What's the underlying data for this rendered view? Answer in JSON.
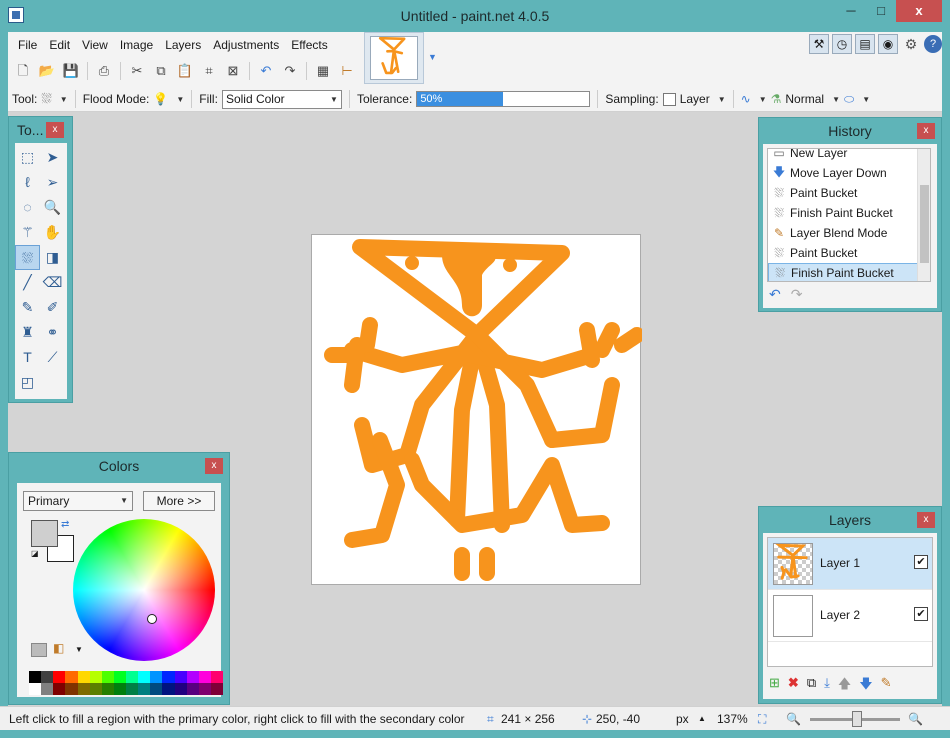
{
  "window": {
    "title": "Untitled - paint.net 4.0.5",
    "minimize": "─",
    "maximize": "□",
    "close": "x"
  },
  "menu": [
    "File",
    "Edit",
    "View",
    "Image",
    "Layers",
    "Adjustments",
    "Effects"
  ],
  "toolbar_top": {
    "tool_label": "Tool:",
    "flood_mode_label": "Flood Mode:",
    "fill_label": "Fill:",
    "fill_value": "Solid Color",
    "tolerance_label": "Tolerance:",
    "tolerance_value": "50%",
    "tolerance_fraction": 0.5,
    "sampling_label": "Sampling:",
    "sampling_value": "Layer",
    "blend_value": "Normal"
  },
  "history": {
    "title": "History",
    "close": "x",
    "items": [
      {
        "label": "New Layer",
        "icon": "new-layer-icon",
        "selected": false
      },
      {
        "label": "Move Layer Down",
        "icon": "move-down-icon",
        "selected": false
      },
      {
        "label": "Paint Bucket",
        "icon": "paint-bucket-icon",
        "selected": false
      },
      {
        "label": "Finish Paint Bucket",
        "icon": "paint-bucket-icon",
        "selected": false
      },
      {
        "label": "Layer Blend Mode",
        "icon": "layer-properties-icon",
        "selected": false
      },
      {
        "label": "Paint Bucket",
        "icon": "paint-bucket-icon",
        "selected": false
      },
      {
        "label": "Finish Paint Bucket",
        "icon": "paint-bucket-icon",
        "selected": true
      }
    ]
  },
  "tools": {
    "title": "To...",
    "close": "x"
  },
  "colors": {
    "title": "Colors",
    "close": "x",
    "mode": "Primary",
    "more_button": "More >>",
    "primary": "#cfcfcf",
    "secondary": "#ffffff",
    "palette": [
      "#000000",
      "#404040",
      "#ff0000",
      "#ff6a00",
      "#ffd800",
      "#b6ff00",
      "#4cff00",
      "#00ff21",
      "#00ff90",
      "#00ffff",
      "#0094ff",
      "#0026ff",
      "#4800ff",
      "#b200ff",
      "#ff00dc",
      "#ff006e",
      "#ffffff",
      "#808080",
      "#7f0000",
      "#7f3300",
      "#7f6a00",
      "#5b7f00",
      "#267f00",
      "#007f0e",
      "#007f46",
      "#007f7f",
      "#004a7f",
      "#00137f",
      "#21007f",
      "#57007f",
      "#7f006e",
      "#7f0037"
    ]
  },
  "layers": {
    "title": "Layers",
    "close": "x",
    "items": [
      {
        "name": "Layer 1",
        "visible": true,
        "selected": true
      },
      {
        "name": "Layer 2",
        "visible": true,
        "selected": false
      }
    ]
  },
  "status": {
    "hint": "Left click to fill a region with the primary color, right click to fill with the secondary color",
    "size": "241 × 256",
    "cursor": "250, -40",
    "units": "px",
    "zoom": "137%"
  },
  "colors_theme": {
    "accent": "#5fb4b8",
    "paint": "#f7941d",
    "selection": "#cce4f7"
  }
}
